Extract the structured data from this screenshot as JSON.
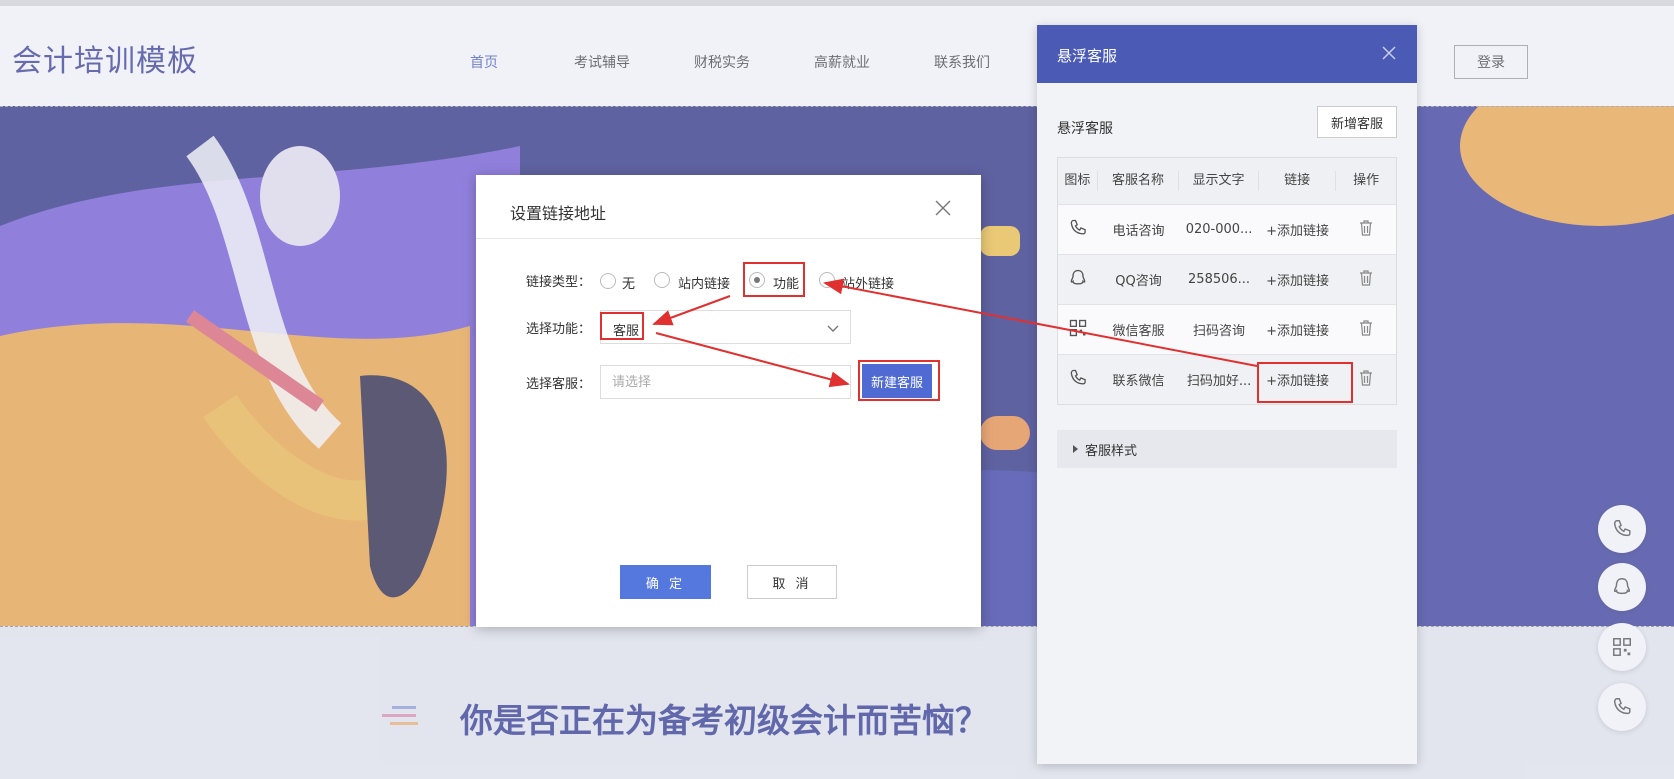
{
  "site": {
    "logo": "会计培训模板",
    "nav": [
      "首页",
      "考试辅导",
      "财税实务",
      "高薪就业",
      "联系我们"
    ],
    "login_label": "登录",
    "section_title": "你是否正在为备考初级会计而苦恼？",
    "colors": {
      "brand": "#232a8a",
      "accent": "#3b53b5",
      "hero_bg": "#1f237b"
    }
  },
  "float_buttons": [
    "phone-icon",
    "qq-icon",
    "qrcode-icon",
    "phone-icon"
  ],
  "side_panel": {
    "title": "悬浮客服",
    "section_label": "悬浮客服",
    "add_button": "新增客服",
    "table": {
      "headers": [
        "图标",
        "客服名称",
        "显示文字",
        "链接",
        "操作"
      ],
      "rows": [
        {
          "icon": "phone-icon",
          "name": "电话咨询",
          "text": "020-000...",
          "link": "+添加链接"
        },
        {
          "icon": "qq-icon",
          "name": "QQ咨询",
          "text": "258506...",
          "link": "+添加链接"
        },
        {
          "icon": "qrcode-icon",
          "name": "微信客服",
          "text": "扫码咨询",
          "link": "+添加链接"
        },
        {
          "icon": "phone-icon",
          "name": "联系微信",
          "text": "扫码加好...",
          "link": "+添加链接"
        }
      ]
    },
    "style_section": "客服样式"
  },
  "modal": {
    "title": "设置链接地址",
    "link_type_label": "链接类型：",
    "link_types": [
      "无",
      "站内链接",
      "功能",
      "站外链接"
    ],
    "link_type_selected": "功能",
    "function_label": "选择功能：",
    "function_value": "客服",
    "service_label": "选择客服：",
    "service_placeholder": "请选择",
    "new_service_button": "新建客服",
    "confirm": "确 定",
    "cancel": "取 消"
  },
  "annotation_color": "#e03030"
}
